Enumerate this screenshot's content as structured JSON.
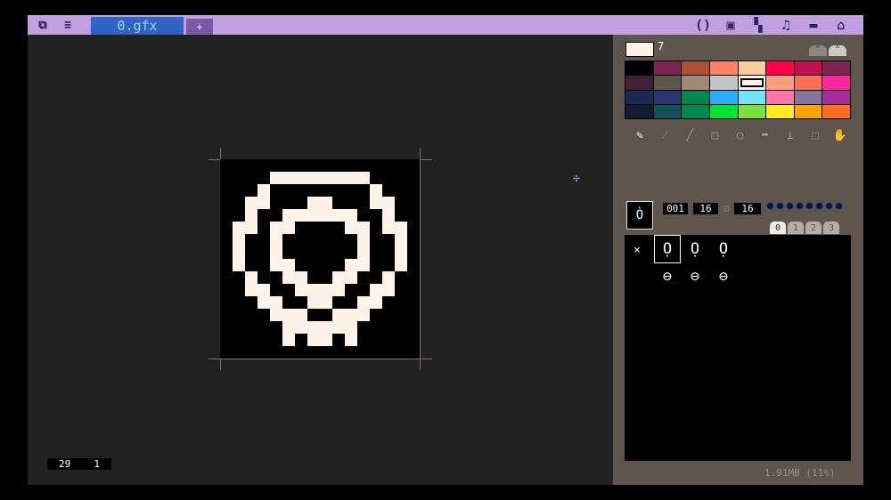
{
  "titlebar": {
    "logo_icon": "pico-logo-icon",
    "menu_icon": "hamburger-menu-icon",
    "tab_label": "0.gfx",
    "add_tab_label": "+",
    "tools": [
      "code-braces-icon",
      "sprite-icon",
      "map-icon",
      "music-note-icon",
      "sfx-icon",
      "tv-icon"
    ]
  },
  "statusbar": {
    "x": "29",
    "y": "1"
  },
  "panel": {
    "current_color": "7",
    "palette_tabs": [
      "^",
      "^"
    ],
    "palette": [
      "#000000",
      "#7e2553",
      "#ab5236",
      "#ff8066",
      "#ffcca0",
      "#ff004d",
      "#be1250",
      "#7e2553",
      "#422136",
      "#5f574f",
      "#a28879",
      "#c2c3c7",
      "#fff1e8",
      "#ff9d81",
      "#ff6e59",
      "#ff27a1",
      "#1d2b53",
      "#29366f",
      "#008751",
      "#29adff",
      "#6fe6ff",
      "#ff77a8",
      "#83769c",
      "#a62c9c",
      "#111d35",
      "#125359",
      "#00894c",
      "#00e436",
      "#7be044",
      "#ffec27",
      "#ffa300",
      "#ff6c24"
    ],
    "selected_color_index": 12,
    "tools": [
      "pencil-icon",
      "brush-icon",
      "line-icon",
      "rectangle-icon",
      "circle-icon",
      "fill-icon",
      "stamp-icon",
      "select-icon",
      "hand-icon"
    ],
    "sprite_index": "001",
    "width": "16",
    "height": "16",
    "lock_icon": "lock-icon",
    "bank_tabs": [
      "0",
      "1",
      "2",
      "3"
    ],
    "empty_marker": "×",
    "memory": "1.91MB (11%)"
  }
}
